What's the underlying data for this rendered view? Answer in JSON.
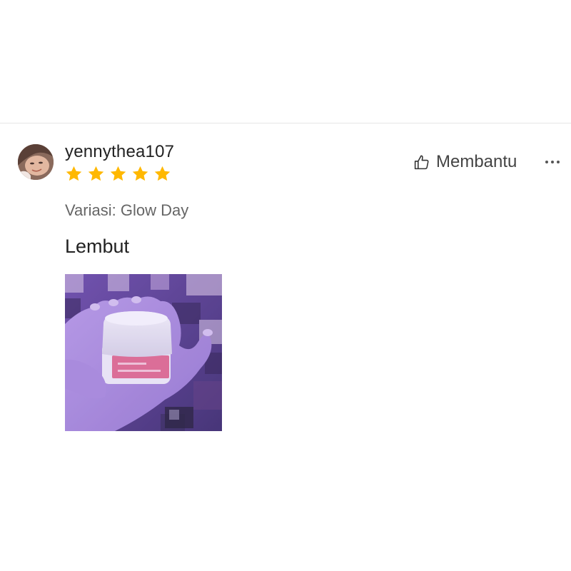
{
  "review": {
    "username": "yennythea107",
    "rating": 5,
    "variation": "Variasi: Glow Day",
    "text": "Lembut",
    "helpful_label": "Membantu",
    "more_icon": "ellipsis-icon",
    "helpful_icon": "thumbs-up-icon",
    "avatar_icon": "user-avatar",
    "photo_icon": "review-photo-cream-jar"
  },
  "colors": {
    "star": "#FFB800",
    "divider": "#e6e6e6",
    "text_primary": "#222222",
    "text_secondary": "#666666"
  }
}
